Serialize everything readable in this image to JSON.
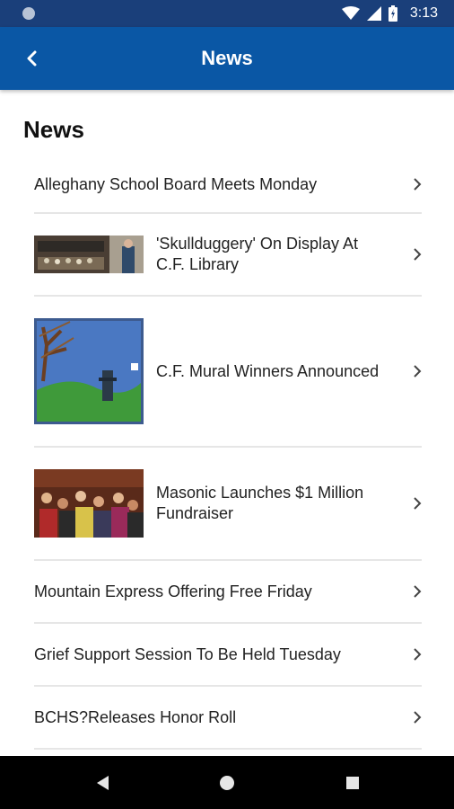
{
  "status_bar": {
    "time": "3:13",
    "icons": [
      "notification-dot-icon",
      "wifi-icon",
      "signal-icon",
      "battery-icon"
    ]
  },
  "app_bar": {
    "title": "News",
    "back_icon": "chevron-left-icon",
    "color": "#0a57a5"
  },
  "page": {
    "heading": "News"
  },
  "news": [
    {
      "title": "Alleghany School Board Meets Monday",
      "has_image": false
    },
    {
      "title": "'Skullduggery' On Display At C.F. Library",
      "has_image": true,
      "image": "library-display-photo"
    },
    {
      "title": "C.F. Mural Winners Announced",
      "has_image": true,
      "image": "mural-painting-photo"
    },
    {
      "title": "Masonic Launches $1 Million Fundraiser",
      "has_image": true,
      "image": "event-crowd-photo"
    },
    {
      "title": "Mountain Express Offering Free Friday",
      "has_image": false
    },
    {
      "title": "Grief Support Session To Be Held Tuesday",
      "has_image": false
    },
    {
      "title": "BCHS?Releases Honor Roll",
      "has_image": false
    }
  ],
  "nav_bar": {
    "buttons": [
      "back-triangle-icon",
      "home-circle-icon",
      "recents-square-icon"
    ]
  }
}
